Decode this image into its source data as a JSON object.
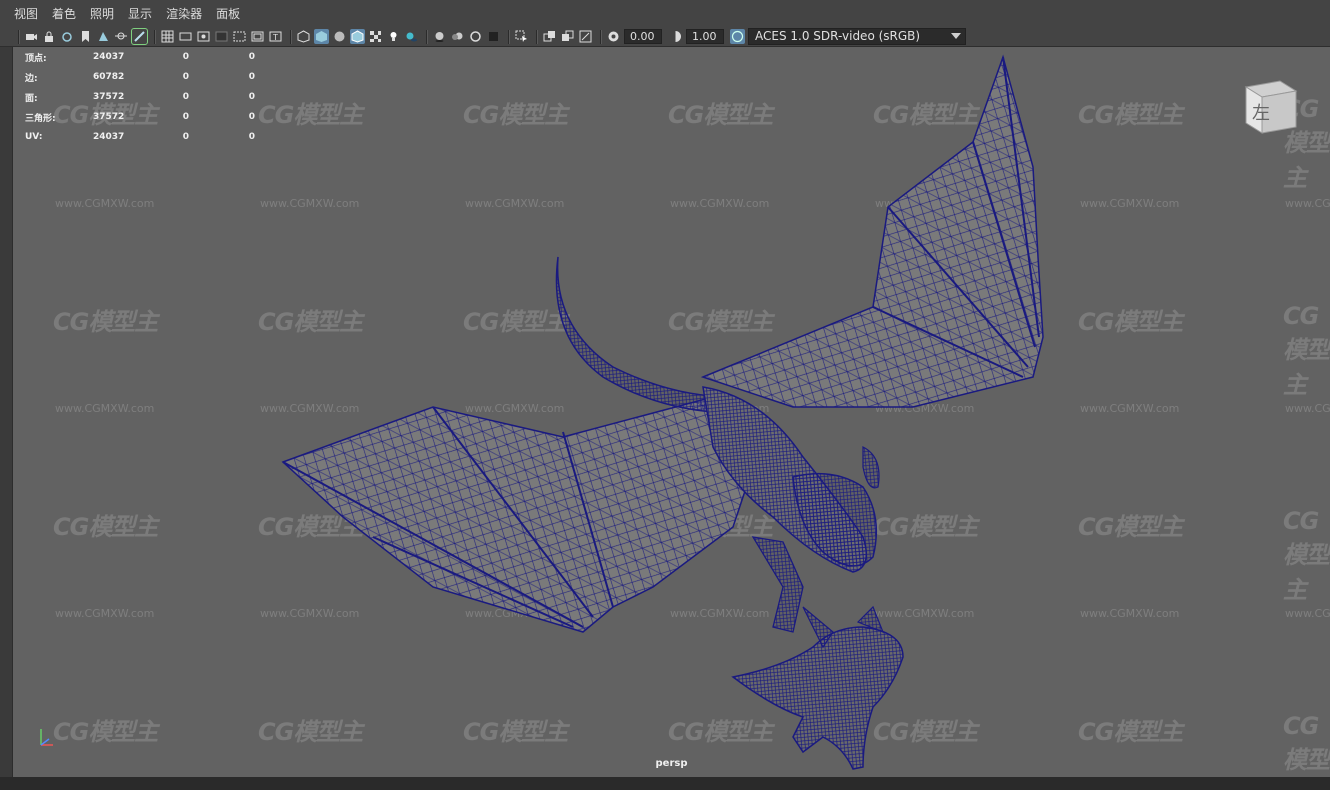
{
  "menu": {
    "items": [
      "视图",
      "着色",
      "照明",
      "显示",
      "渲染器",
      "面板"
    ]
  },
  "toolbar": {
    "exposure_value": "0.00",
    "gamma_value": "1.00",
    "colorspace_label": "ACES 1.0 SDR-video (sRGB)"
  },
  "hud": {
    "rows": [
      {
        "label": "顶点:",
        "v1": "24037",
        "v2": "0",
        "v3": "0"
      },
      {
        "label": "边:",
        "v1": "60782",
        "v2": "0",
        "v3": "0"
      },
      {
        "label": "面:",
        "v1": "37572",
        "v2": "0",
        "v3": "0"
      },
      {
        "label": "三角形:",
        "v1": "37572",
        "v2": "0",
        "v3": "0"
      },
      {
        "label": "UV:",
        "v1": "24037",
        "v2": "0",
        "v3": "0"
      }
    ]
  },
  "viewcube": {
    "face_label": "左"
  },
  "camera_label": "persp",
  "watermark": {
    "logo": "CG模型主",
    "url": "www.CGMXW.com"
  },
  "colors": {
    "wireframe": "#1a1a80",
    "viewport_bg": "#626262",
    "panel_bg": "#444444",
    "active_icon": "#5d86a8"
  }
}
